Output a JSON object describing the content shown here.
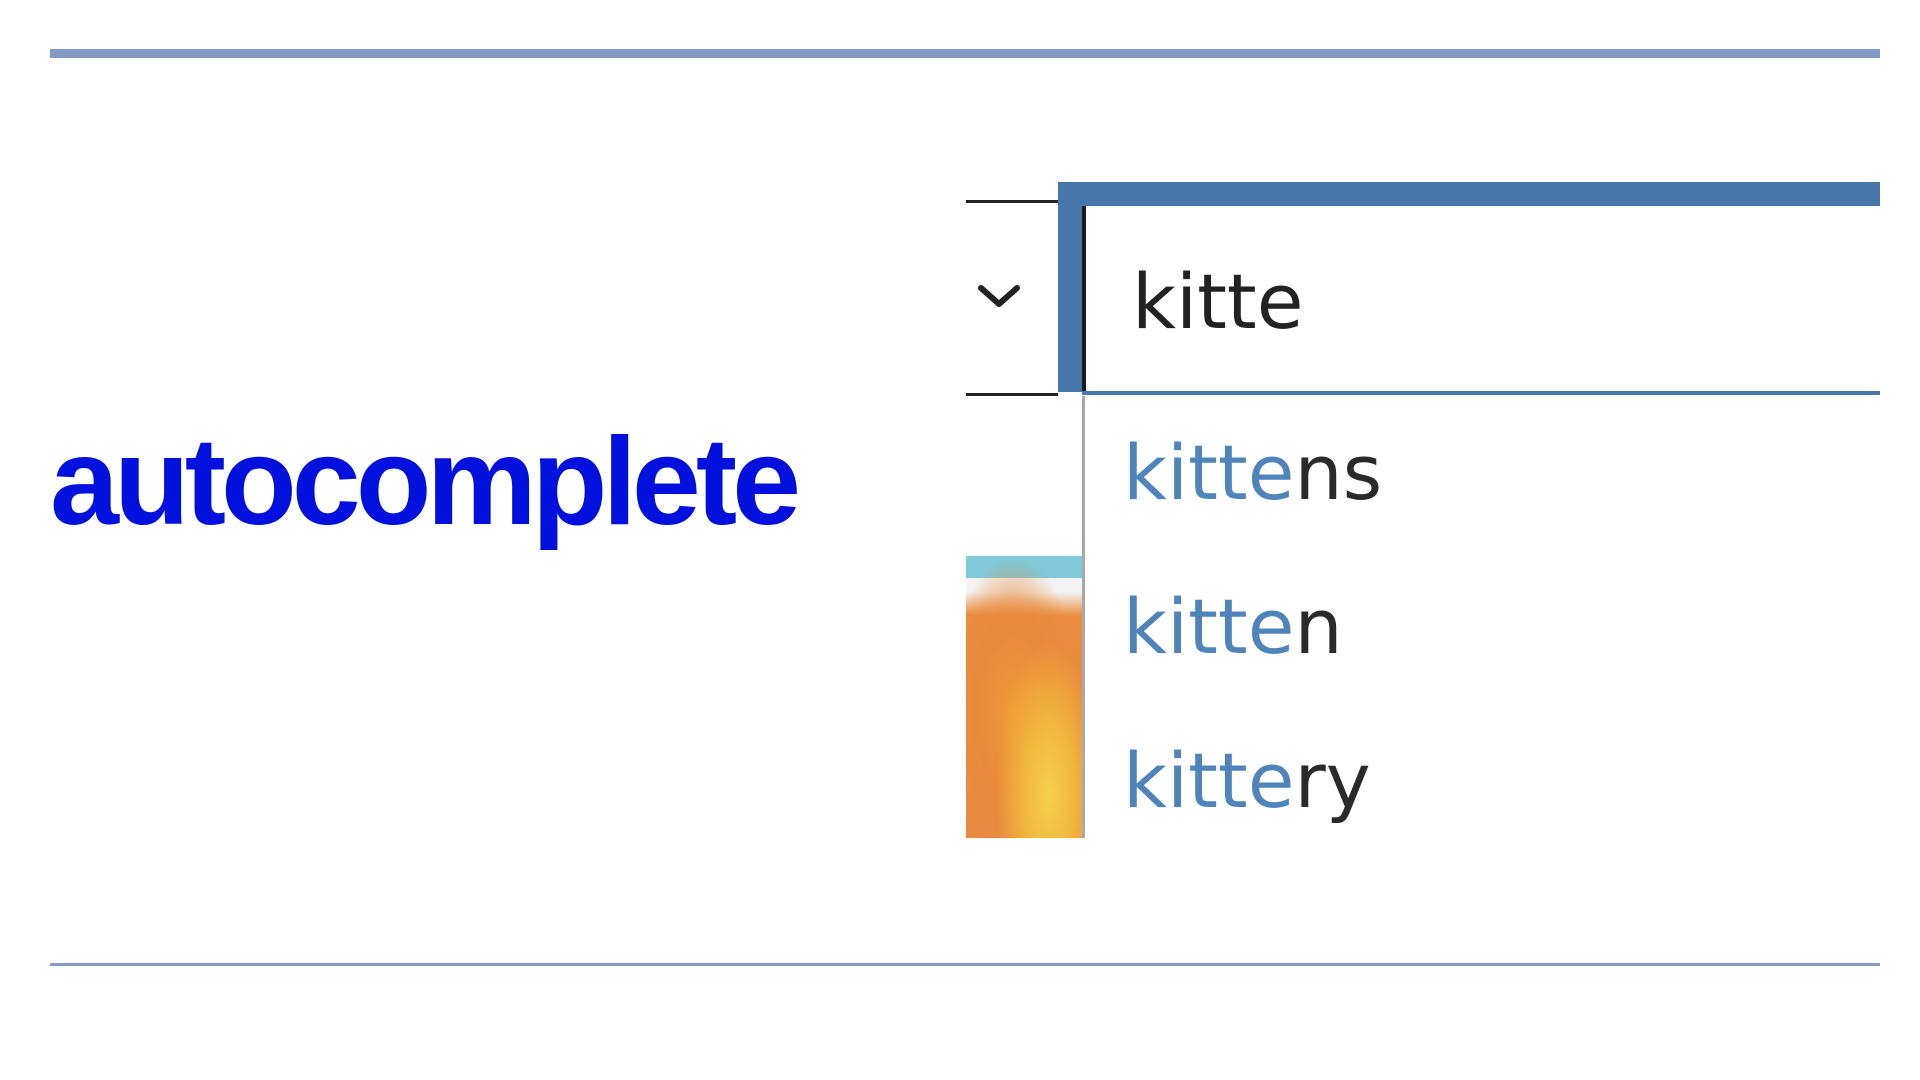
{
  "slide": {
    "title": "autocomplete",
    "title_color": "#0011dd",
    "rule_color": "#8399c6"
  },
  "search": {
    "value": "kitte",
    "dropdown_icon": "chevron-down-icon",
    "focus_color": "#4677ab"
  },
  "suggestions": [
    {
      "match": "kitte",
      "rest": "ns"
    },
    {
      "match": "kitte",
      "rest": "n"
    },
    {
      "match": "kitte",
      "rest": "ry"
    }
  ],
  "colors": {
    "match_text": "#4f84bb",
    "rest_text": "#2a2a2a"
  }
}
